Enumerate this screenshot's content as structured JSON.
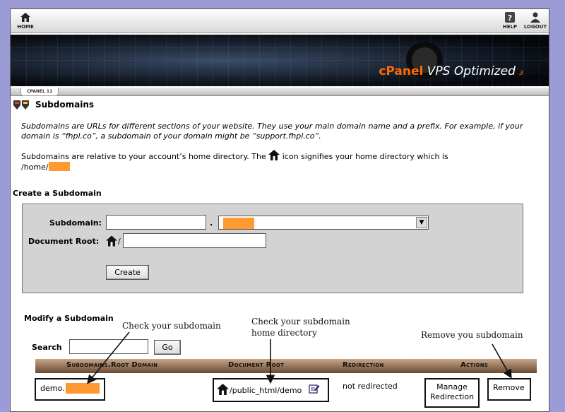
{
  "topbar": {
    "home": "HOME",
    "help": "HELP",
    "logout": "LOGOUT"
  },
  "banner": {
    "brand_cpanel": "cPanel",
    "brand_rest": " VPS Optimized",
    "brand_sub": "3"
  },
  "crumb": "CPANEL 11",
  "page": {
    "title": "Subdomains",
    "intro": "Subdomains are URLs for different sections of your website. They use your main domain name and a prefix. For example, if your domain is “fhpl.co”, a subdomain of your domain might be “support.fhpl.co”.",
    "home_dir_pre": "Subdomains are relative to your account’s home directory. The ",
    "home_dir_post": " icon signifies your home directory which is",
    "home_path": "/home/"
  },
  "create": {
    "heading": "Create a Subdomain",
    "subdomain_label": "Subdomain:",
    "subdomain_value": "",
    "dot": ".",
    "docroot_label": "Document Root:",
    "docroot_slash": "/",
    "docroot_value": "",
    "create_button": "Create"
  },
  "modify": {
    "heading": "Modify a Subdomain",
    "search_label": "Search",
    "search_value": "",
    "go_button": "Go",
    "columns": [
      "Subdomains.Root Domain",
      "Document Root",
      "Redirection",
      "Actions"
    ],
    "row": {
      "subdomain": "demo.",
      "docroot": "/public_html/demo",
      "redirection": "not redirected",
      "manage_line1": "Manage",
      "manage_line2": "Redirection",
      "remove": "Remove"
    }
  },
  "annotations": {
    "check_subdomain": "Check your subdomain",
    "check_home_line1": "Check your subdomain",
    "check_home_line2": "home directory",
    "remove_subdomain": "Remove you subdomain"
  },
  "colors": {
    "accent": "#ff6a00",
    "redaction": "#ff9a33",
    "form_bg": "#d3d3d3",
    "table_header": "#8b6a50"
  }
}
